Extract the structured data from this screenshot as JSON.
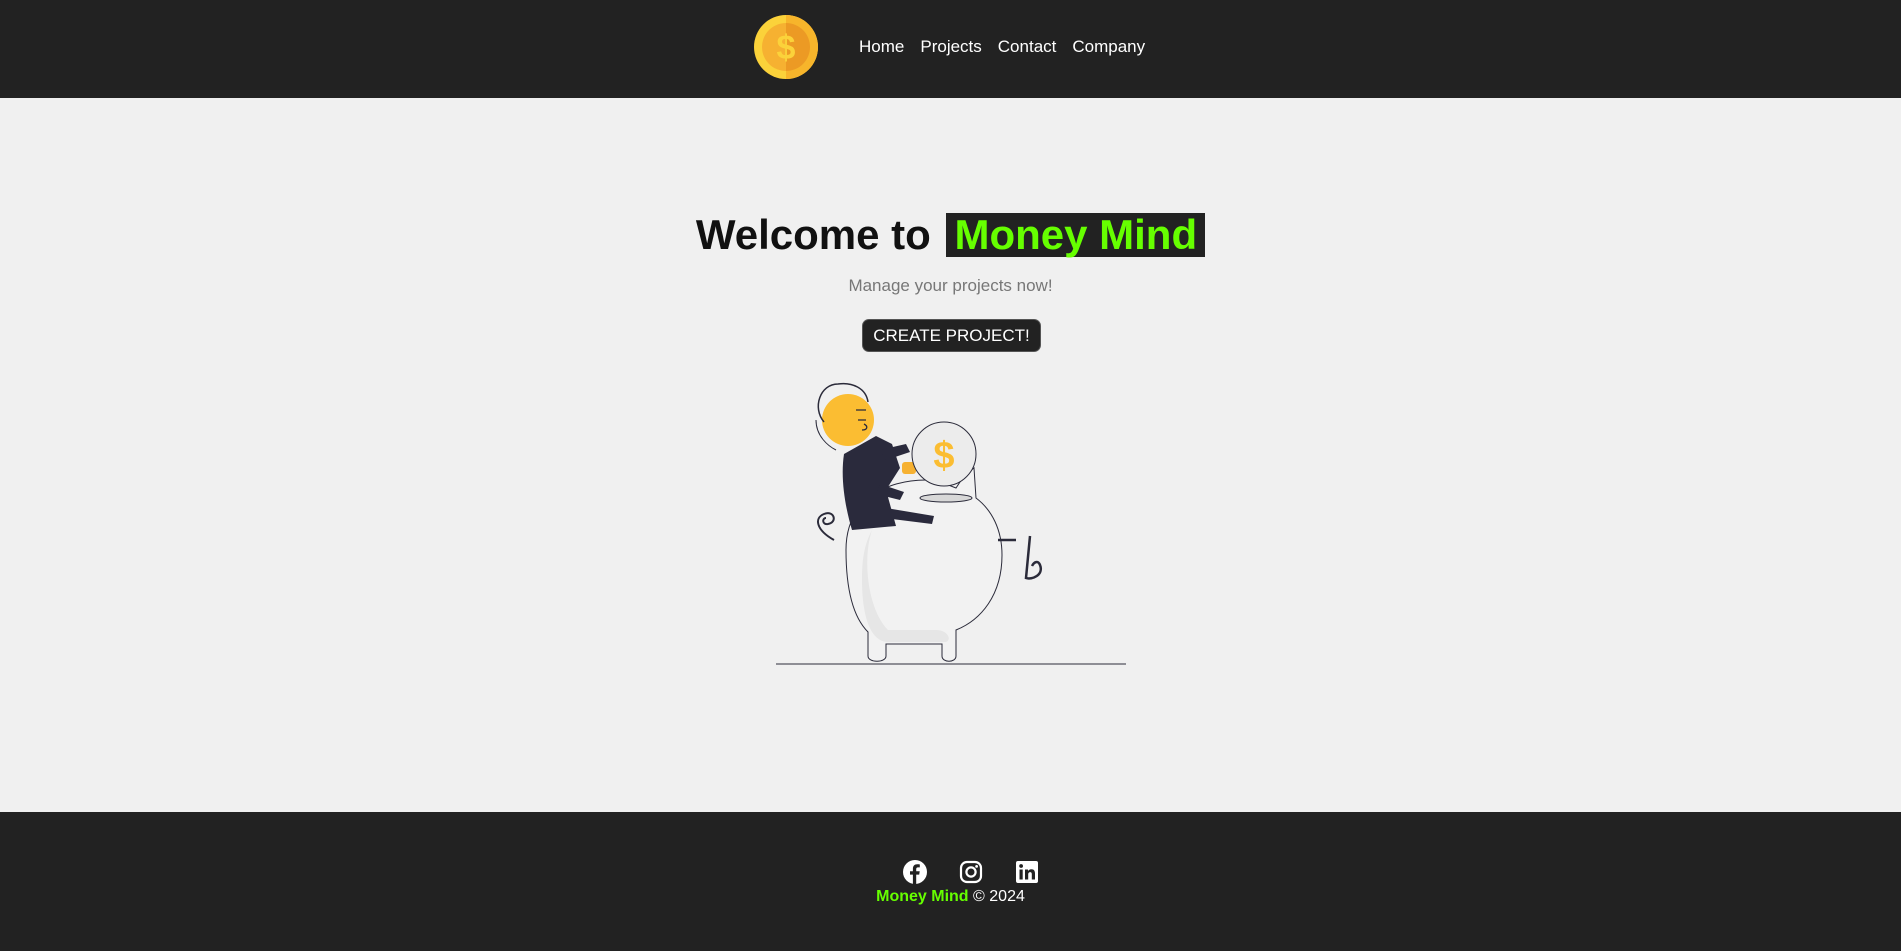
{
  "header": {
    "logo_icon": "dollar-coin-icon",
    "nav": [
      {
        "label": "Home"
      },
      {
        "label": "Projects"
      },
      {
        "label": "Contact"
      },
      {
        "label": "Company"
      }
    ]
  },
  "hero": {
    "title_prefix": "Welcome to",
    "title_brand": "Money Mind",
    "subtitle": "Manage your projects now!",
    "cta_label": "CREATE PROJECT!",
    "illustration_icon": "person-piggy-bank-illustration"
  },
  "footer": {
    "socials": [
      {
        "icon": "facebook-icon"
      },
      {
        "icon": "instagram-icon"
      },
      {
        "icon": "linkedin-icon"
      }
    ],
    "brand": "Money Mind",
    "copyright": "© 2024"
  },
  "colors": {
    "dark": "#222222",
    "accent": "#66ff00",
    "background": "#f0f0f0",
    "coin": "#fbbd32"
  }
}
